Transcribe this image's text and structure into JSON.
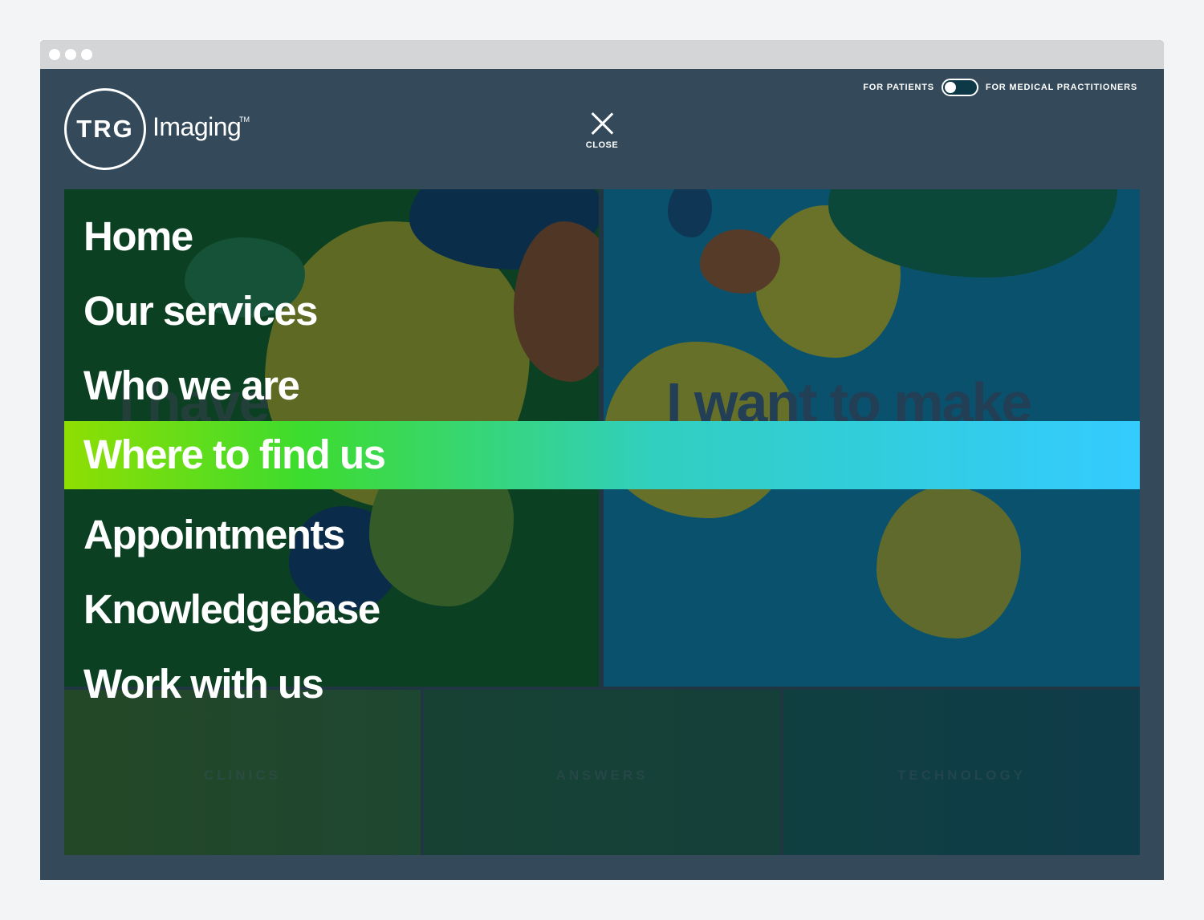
{
  "header": {
    "logo": {
      "mark": "TRG",
      "wordmark": "Imaging",
      "trademark": "TM"
    },
    "close": {
      "label": "CLOSE",
      "icon": "close-icon"
    },
    "audience_toggle": {
      "left_label": "FOR PATIENTS",
      "right_label": "FOR MEDICAL PRACTITIONERS",
      "selected": "FOR PATIENTS"
    }
  },
  "background_panels": {
    "left_heading": "I have",
    "right_heading": "I want to make",
    "tiles": [
      "CLINICS",
      "ANSWERS",
      "TECHNOLOGY"
    ]
  },
  "menu": {
    "items": [
      {
        "label": "Home"
      },
      {
        "label": "Our services"
      },
      {
        "label": "Who we are"
      },
      {
        "label": "Where to find us"
      },
      {
        "label": "Appointments"
      },
      {
        "label": "Knowledgebase"
      },
      {
        "label": "Work with us"
      }
    ],
    "active_item": "Where to find us"
  },
  "colors": {
    "page_bg": "#344a5a",
    "active_gradient_start": "#8fde02",
    "active_gradient_end": "#34cbff",
    "left_panel": "#0e5c1f",
    "right_panel": "#0a7ba6"
  }
}
